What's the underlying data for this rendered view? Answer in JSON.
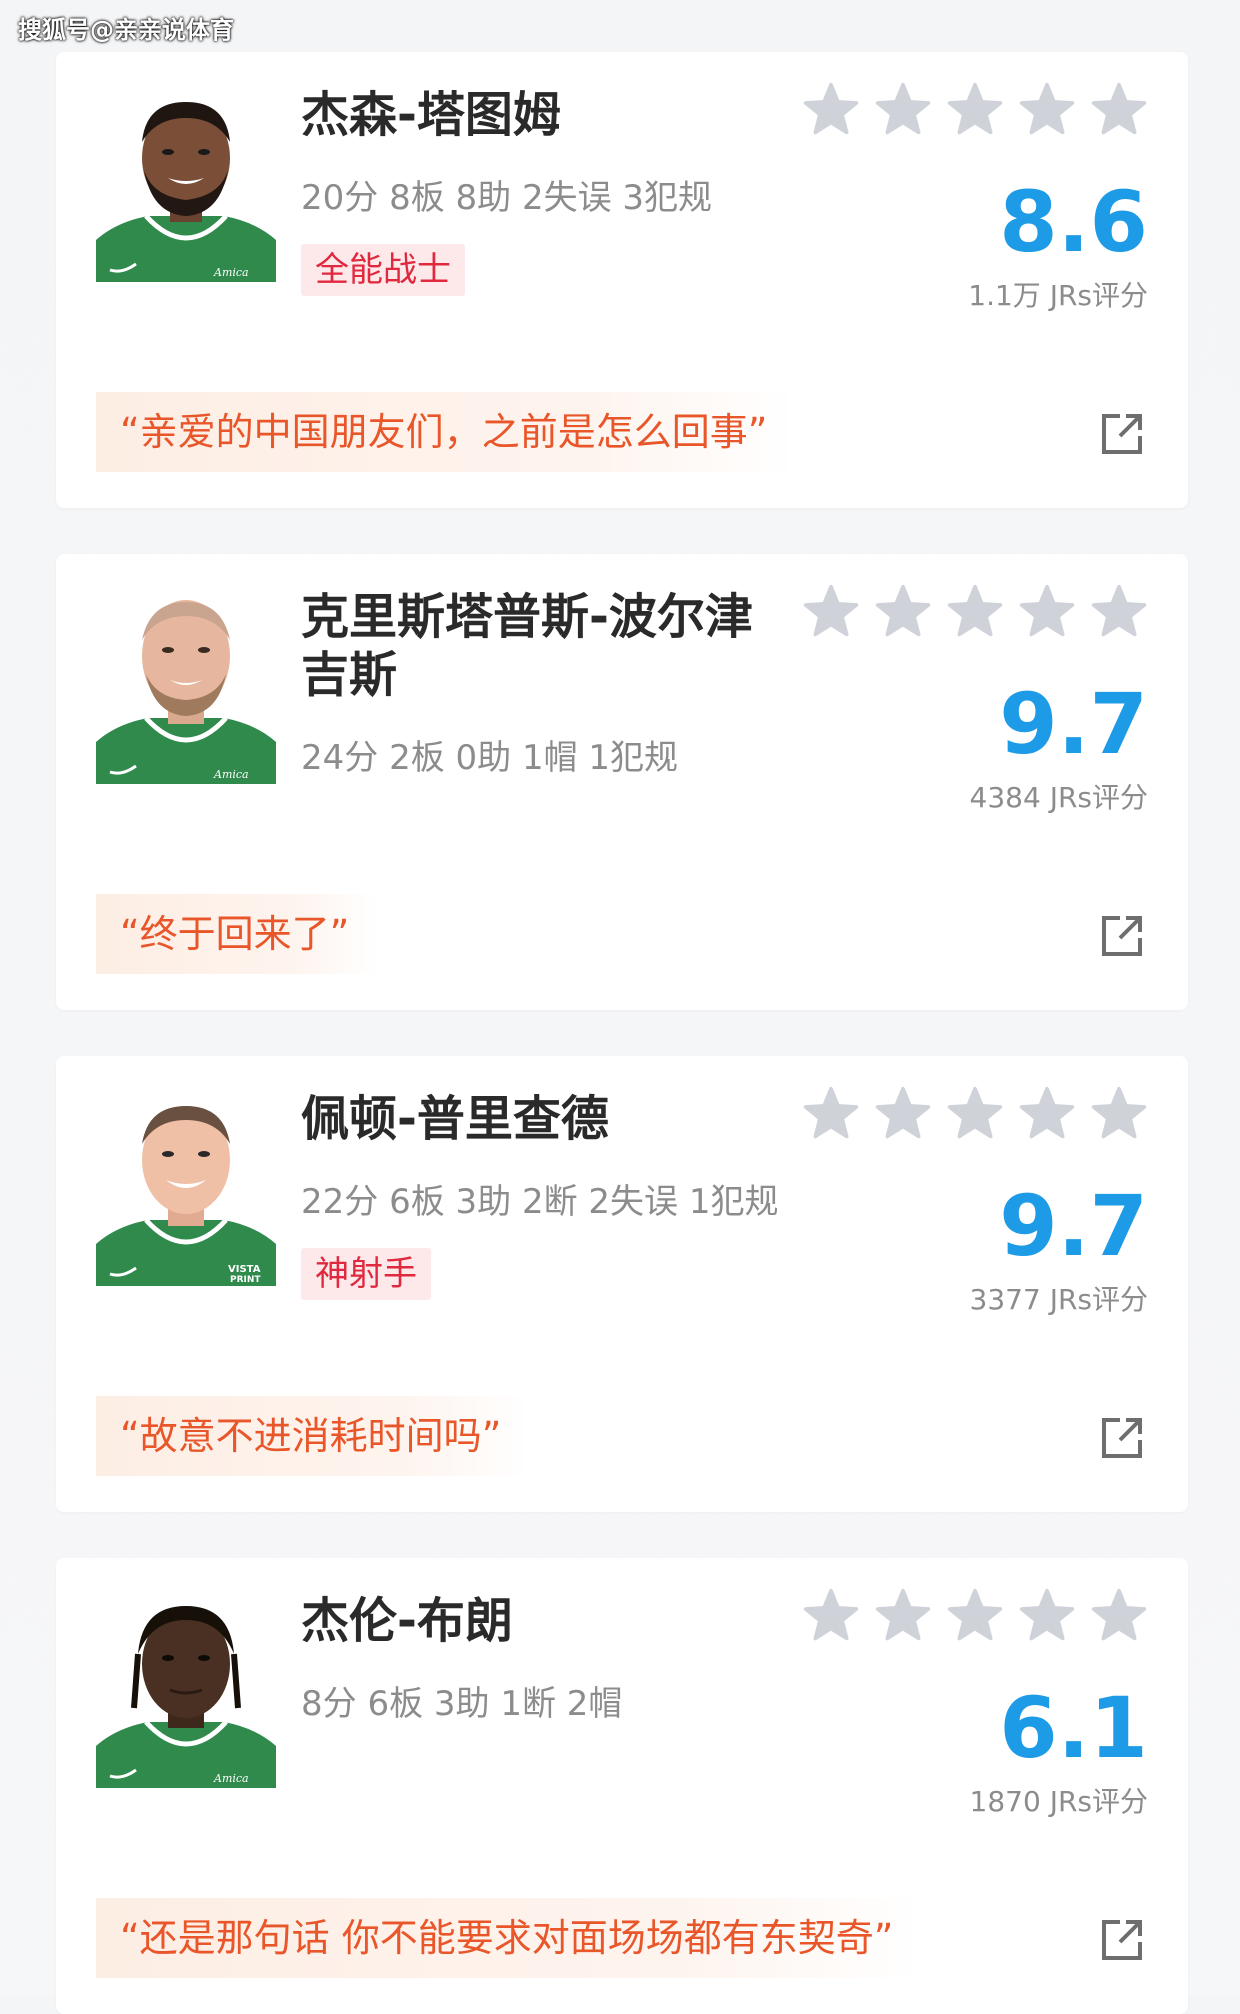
{
  "watermark": "搜狐号@亲亲说体育",
  "cards": [
    {
      "name": "杰森-塔图姆",
      "stats": "20分 8板 8助 2失误 3犯规",
      "tag": "全能战士",
      "rating": "8.6",
      "raters": "1.1万 JRs评分",
      "quote": "“亲爱的中国朋友们，之前是怎么回事”",
      "jersey": "Amica"
    },
    {
      "name": "克里斯塔普斯-波尔津吉斯",
      "stats": "24分 2板 0助 1帽 1犯规",
      "tag": "",
      "rating": "9.7",
      "raters": "4384 JRs评分",
      "quote": "“终于回来了”",
      "jersey": "Amica"
    },
    {
      "name": "佩顿-普里查德",
      "stats": "22分 6板 3助 2断 2失误 1犯规",
      "tag": "神射手",
      "rating": "9.7",
      "raters": "3377 JRs评分",
      "quote": "“故意不进消耗时间吗”",
      "jersey": "VISTA PRINT"
    },
    {
      "name": "杰伦-布朗",
      "stats": "8分 6板 3助 1断 2帽",
      "tag": "",
      "rating": "6.1",
      "raters": "1870 JRs评分",
      "quote": "“还是那句话 你不能要求对面场场都有东契奇”",
      "jersey": "Amica"
    }
  ],
  "colors": {
    "rating": "#1e9be6",
    "tag_text": "#e0283f",
    "tag_bg": "#fde8ea",
    "quote_text": "#e8562a",
    "quote_bg": "#fdeee4",
    "star": "#cfd3d9",
    "jersey": "#2f8a4c"
  },
  "icons": {
    "star": "star-icon",
    "share": "share-external-icon"
  },
  "stars_per_card": 5
}
